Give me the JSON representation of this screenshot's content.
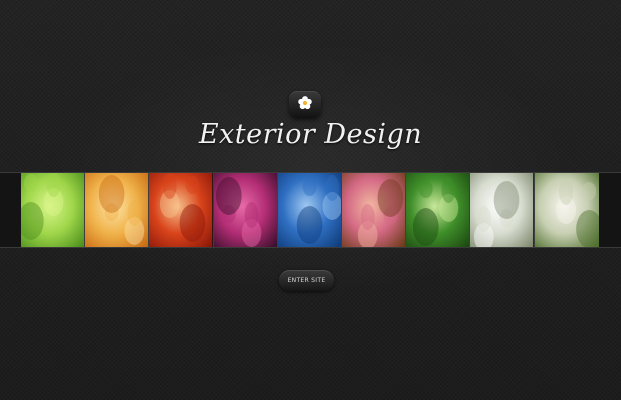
{
  "header": {
    "logo_icon": "flower-icon",
    "title": "Exterior Design"
  },
  "gallery": {
    "tiles": [
      {
        "name": "green-leaves",
        "colors": [
          "#4c8f1c",
          "#9fd64a",
          "#d9f58a"
        ]
      },
      {
        "name": "dandelion-seeds",
        "colors": [
          "#c96a12",
          "#f0b24a",
          "#fde3a8"
        ]
      },
      {
        "name": "red-leaves",
        "colors": [
          "#8b1708",
          "#d8431b",
          "#f7c18c"
        ]
      },
      {
        "name": "purple-flower",
        "colors": [
          "#3a0f2c",
          "#b22d74",
          "#e86aa8"
        ]
      },
      {
        "name": "blue-water-drop",
        "colors": [
          "#0f3c7a",
          "#2f6fc2",
          "#9fc9f2"
        ]
      },
      {
        "name": "pink-blossoms",
        "colors": [
          "#6d3a1a",
          "#d46a85",
          "#f2b7a0"
        ]
      },
      {
        "name": "green-grass",
        "colors": [
          "#1d4a12",
          "#3f8f2a",
          "#c9e89a"
        ]
      },
      {
        "name": "white-flowers",
        "colors": [
          "#7f8a70",
          "#d7dccf",
          "#ffffff"
        ]
      },
      {
        "name": "white-blossom-branch",
        "colors": [
          "#4e6e2c",
          "#c7cfb2",
          "#f7f5ee"
        ]
      }
    ]
  },
  "enter_button": {
    "label": "ENTER SITE"
  },
  "colors": {
    "background": "#1f1f1f",
    "title_text": "#f2f2f2",
    "button_text": "#d8d8d8"
  }
}
